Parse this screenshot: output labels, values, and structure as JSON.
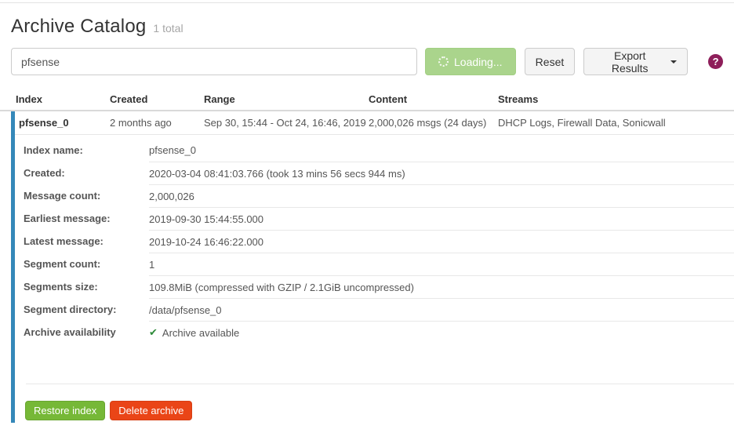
{
  "page": {
    "title": "Archive Catalog",
    "total_badge": "1 total"
  },
  "toolbar": {
    "search_value": "pfsense",
    "loading_label": "Loading...",
    "reset_label": "Reset",
    "export_label": "Export Results",
    "help_glyph": "?"
  },
  "table": {
    "headers": {
      "index": "Index",
      "created": "Created",
      "range": "Range",
      "content": "Content",
      "streams": "Streams"
    },
    "row": {
      "index": "pfsense_0",
      "created": "2 months ago",
      "range": "Sep 30, 15:44 - Oct 24, 16:46, 2019",
      "content": "2,000,026 msgs (24 days)",
      "streams": "DHCP Logs, Firewall Data, Sonicwall"
    }
  },
  "details": {
    "rows": [
      {
        "label": "Index name:",
        "value": "pfsense_0"
      },
      {
        "label": "Created:",
        "value": "2020-03-04 08:41:03.766 (took 13 mins 56 secs 944 ms)"
      },
      {
        "label": "Message count:",
        "value": "2,000,026"
      },
      {
        "label": "Earliest message:",
        "value": "2019-09-30 15:44:55.000"
      },
      {
        "label": "Latest message:",
        "value": "2019-10-24 16:46:22.000"
      },
      {
        "label": "Segment count:",
        "value": "1"
      },
      {
        "label": "Segments size:",
        "value": "109.8MiB (compressed with GZIP / 2.1GiB uncompressed)"
      },
      {
        "label": "Segment directory:",
        "value": "/data/pfsense_0"
      },
      {
        "label": "Archive availability",
        "value": "Archive available",
        "icon_glyph": "✔"
      }
    ]
  },
  "footer": {
    "restore_label": "Restore index",
    "delete_label": "Delete archive"
  },
  "colors": {
    "accent_bar": "#3588b9",
    "loading_button_green": "#aad48c",
    "restore_button_green": "#76b837",
    "delete_button_red": "#ea4517",
    "check_green": "#2e8b3a",
    "help_icon_magenta": "#8e1e5a"
  }
}
